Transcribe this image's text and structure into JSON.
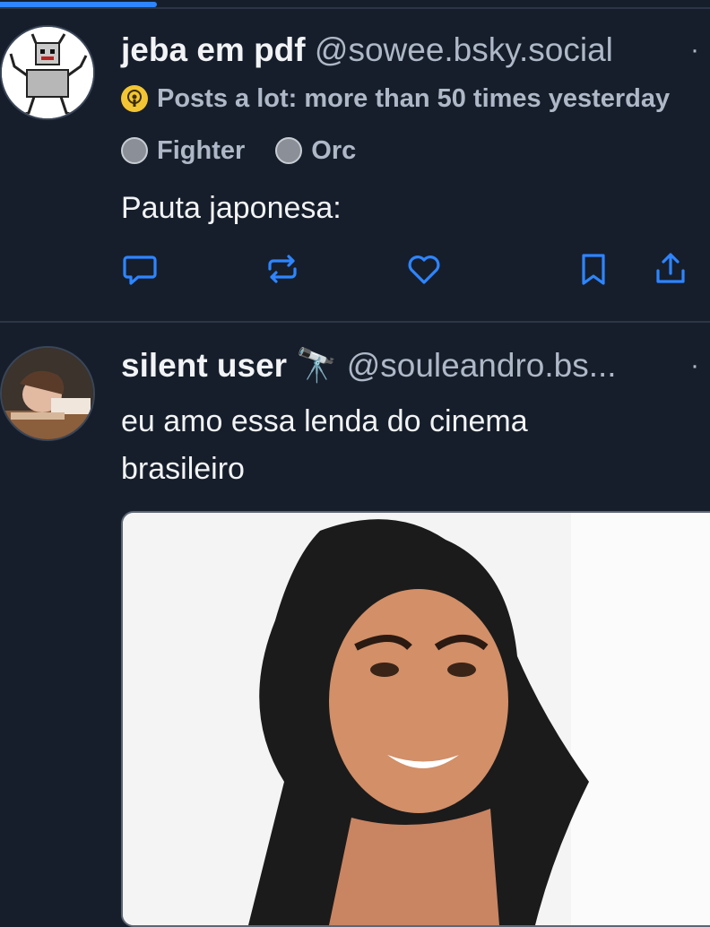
{
  "colors": {
    "background": "#161e2b",
    "accent": "#2e85ff",
    "muted": "#aeb8c7",
    "text": "#f1f3f5"
  },
  "posts": [
    {
      "author": {
        "name": "jeba em pdf",
        "handle": "@sowee.bsky.social",
        "more": "·",
        "avatar": "pixel-art-creature-avatar"
      },
      "badges": [
        {
          "icon": "podcast-badge-icon",
          "label": "Posts a lot: more than 50 times yesterday"
        },
        {
          "icon": "fighter-badge-icon",
          "label": "Fighter"
        },
        {
          "icon": "orc-badge-icon",
          "label": "Orc"
        }
      ],
      "text": "Pauta japonesa:",
      "actions": [
        {
          "name": "reply",
          "icon": "comment-icon"
        },
        {
          "name": "repost",
          "icon": "repost-icon"
        },
        {
          "name": "like",
          "icon": "heart-icon"
        },
        {
          "name": "bookmark",
          "icon": "bookmark-icon"
        },
        {
          "name": "share",
          "icon": "share-icon"
        }
      ]
    },
    {
      "author": {
        "name": "silent user",
        "emoji": "🔭",
        "handle": "@souleandro.bs...",
        "more": "·",
        "avatar": "photo-avatar"
      },
      "text_lines": [
        "eu amo essa lenda do cinema",
        "brasileiro"
      ],
      "media": {
        "type": "image",
        "icon": "image-thumbnail"
      }
    }
  ]
}
